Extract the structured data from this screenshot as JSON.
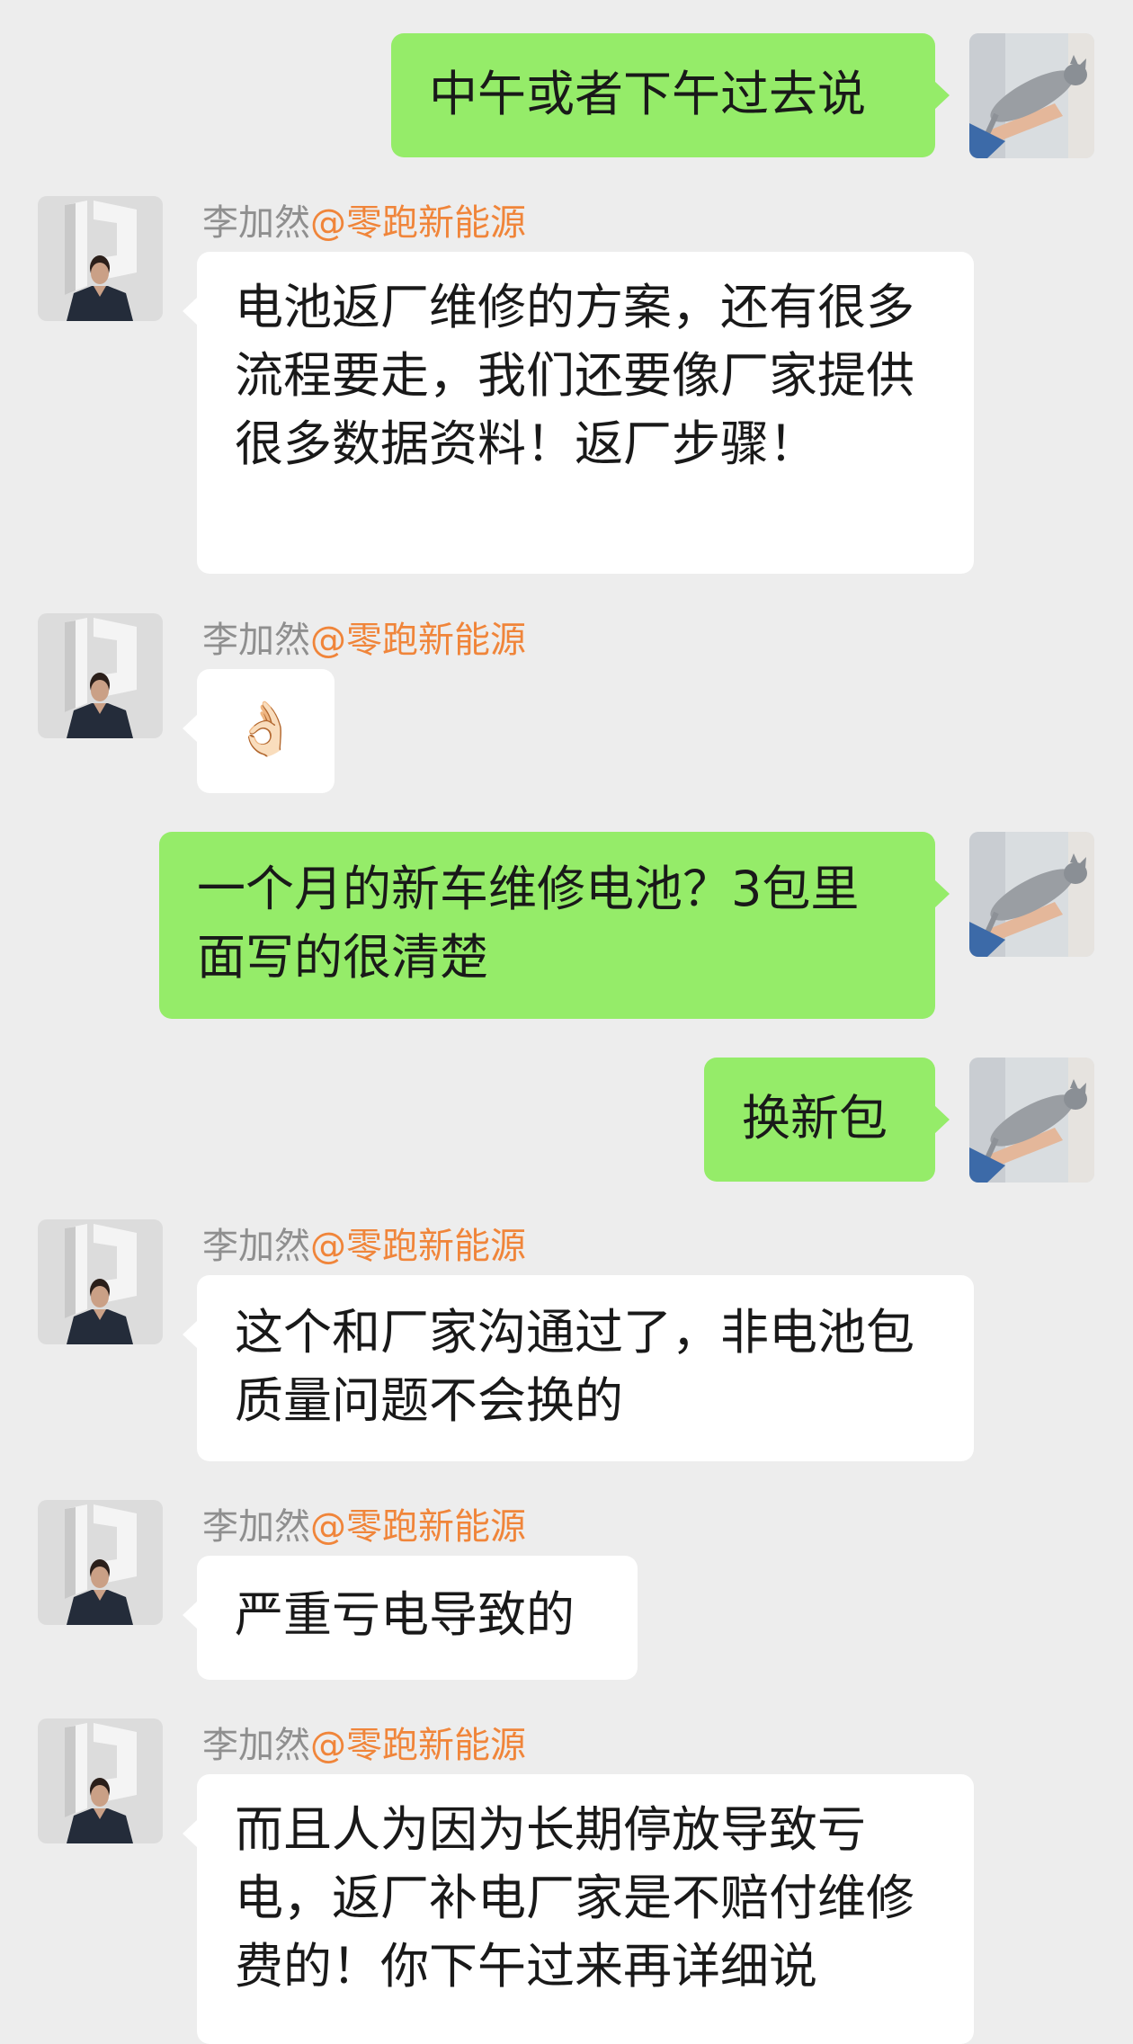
{
  "sender": {
    "name": "李加然",
    "org": "@零跑新能源"
  },
  "messages": [
    {
      "text": "中午或者下午过去说"
    },
    {
      "text": "电池返厂维修的方案，还有很多流程要走，我们还要像厂家提供很多数据资料！返厂步骤！"
    },
    {
      "text": "👌🏻"
    },
    {
      "text": "一个月的新车维修电池？3包里面写的很清楚"
    },
    {
      "text": "换新包"
    },
    {
      "text": "这个和厂家沟通过了，非电池包质量问题不会换的"
    },
    {
      "text": "严重亏电导致的"
    },
    {
      "text": "而且人为因为长期停放导致亏电，返厂补电厂家是不赔付维修费的！你下午过来再详细说"
    }
  ],
  "colors": {
    "background": "#ededed",
    "outgoing_bubble": "#95ec69",
    "incoming_bubble": "#ffffff",
    "org_tag": "#f0853a",
    "sender_name": "#8f8f8f"
  },
  "icons": {
    "self_avatar": "cat-photo-avatar",
    "contact_avatar": "leapmotor-logo-person-avatar"
  }
}
